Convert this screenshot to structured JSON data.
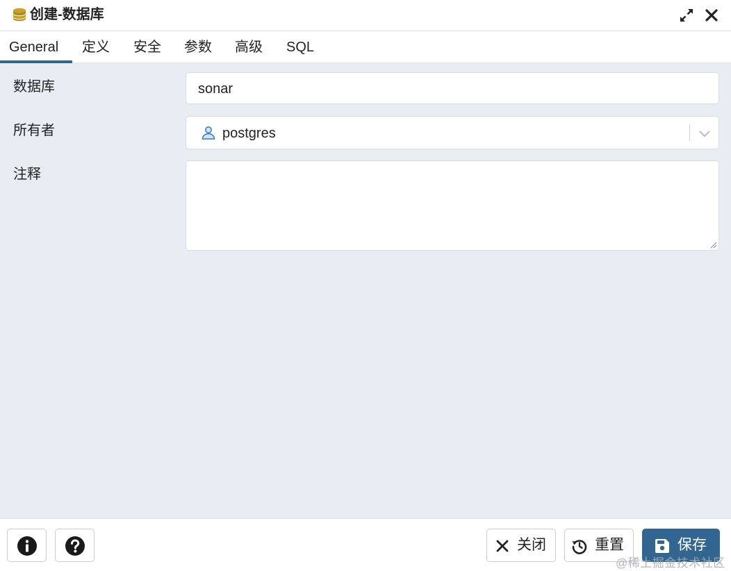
{
  "window": {
    "title": "创建-数据库",
    "icon": "database-icon",
    "maximize_icon": "expand-arrows-icon",
    "close_icon": "close-icon"
  },
  "tabs": [
    {
      "label": "General",
      "active": true
    },
    {
      "label": "定义",
      "active": false
    },
    {
      "label": "安全",
      "active": false
    },
    {
      "label": "参数",
      "active": false
    },
    {
      "label": "高级",
      "active": false
    },
    {
      "label": "SQL",
      "active": false
    }
  ],
  "form": {
    "database": {
      "label": "数据库",
      "value": "sonar"
    },
    "owner": {
      "label": "所有者",
      "value": "postgres",
      "icon": "user-icon"
    },
    "comment": {
      "label": "注释",
      "value": ""
    }
  },
  "footer": {
    "info_icon": "info-icon",
    "help_icon": "help-icon",
    "close_label": "关闭",
    "reset_label": "重置",
    "save_label": "保存"
  },
  "watermark": "@稀土掘金技术社区",
  "colors": {
    "accent": "#326690",
    "background": "#e8ecf3",
    "database_icon": "#c9a227"
  }
}
